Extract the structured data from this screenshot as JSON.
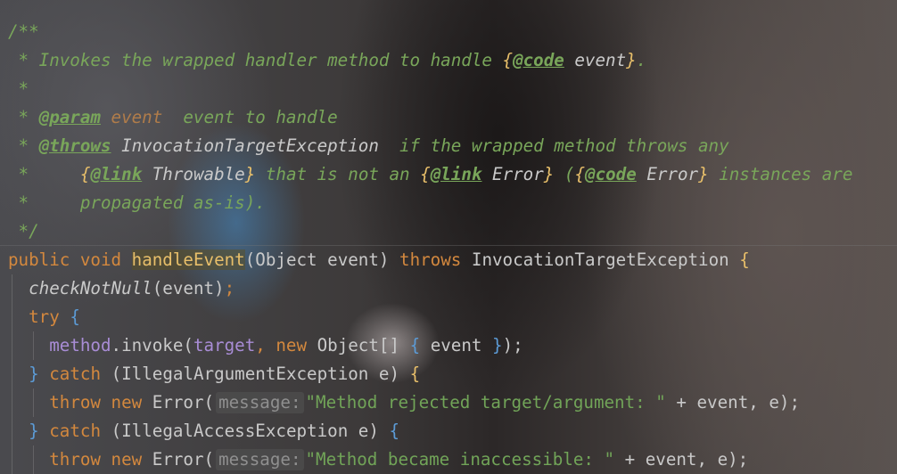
{
  "javadoc": {
    "open": "/**",
    "line1_prefix": " * Invokes the wrapped handler method to handle ",
    "line1_open": "{",
    "line1_tag": "@code",
    "line1_ref": " event",
    "line1_close": "}",
    "line1_end": ".",
    "line2": " *",
    "line3_star": " * ",
    "line3_tag": "@param",
    "line3_param": " event",
    "line3_desc": "  event to handle",
    "line4_star": " * ",
    "line4_tag": "@throws",
    "line4_exc": " InvocationTargetException",
    "line4_desc": "  if the wrapped method throws any",
    "line5_star": " *     ",
    "line5_o1": "{",
    "line5_t1": "@link",
    "line5_r1": " Throwable",
    "line5_c1": "}",
    "line5_mid": " that is not an ",
    "line5_o2": "{",
    "line5_t2": "@link",
    "line5_r2": " Error",
    "line5_c2": "}",
    "line5_paren": " (",
    "line5_o3": "{",
    "line5_t3": "@code",
    "line5_r3": " Error",
    "line5_c3": "}",
    "line5_end": " instances are",
    "line6": " *     propagated as-is).",
    "close": " */"
  },
  "code": {
    "public": "public",
    "void": "void",
    "method_name": "handleEvent",
    "params": "(Object event)",
    "throws": "throws",
    "exception": "InvocationTargetException",
    "open_brace": "{",
    "check_fn": "checkNotNull",
    "check_args": "(event)",
    "semicolon": ";",
    "try": "try",
    "method_field": "method",
    "invoke": ".invoke(",
    "target": "target",
    "comma": ", ",
    "new": "new",
    "object_arr": "Object[]",
    "array_open": "{",
    "array_content": " event ",
    "array_close": "}",
    "invoke_end": ");",
    "catch1_close": "}",
    "catch": "catch",
    "catch1_type": "(IllegalArgumentException e)",
    "throw": "throw",
    "error_ctor": "Error(",
    "hint_label": "message:",
    "msg1": "\"Method rejected target/argument: \"",
    "concat_rest": " + event, e);",
    "catch2_type": "(IllegalAccessException e)",
    "msg2": "\"Method became inaccessible: \""
  },
  "colors": {
    "keyword": "#d3883e",
    "function": "#e8bf6a",
    "field": "#a98dd6",
    "string": "#71a458",
    "doc_comment": "#79a65a",
    "brace": "#5c9bd6"
  }
}
